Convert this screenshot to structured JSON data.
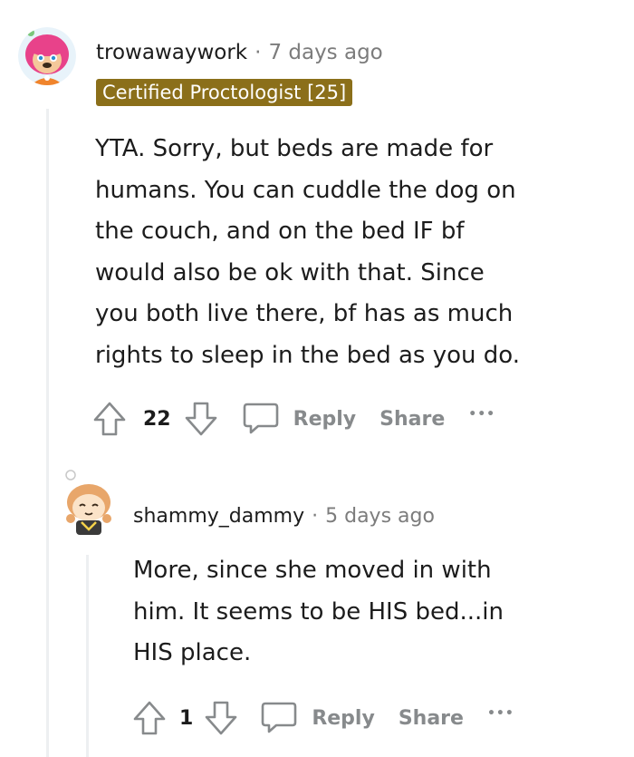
{
  "comments": [
    {
      "username": "trowawaywork",
      "time": "7 days ago",
      "flair": "Certified Proctologist [25]",
      "body_lines": [
        "YTA. Sorry, but beds are made for",
        "humans. You can cuddle the dog on",
        "the couch, and on the bed IF bf",
        "would also be ok with that. Since",
        "you both live there, bf has as much",
        "rights to sleep in the bed as you do."
      ],
      "votes": "22",
      "reply_label": "Reply",
      "share_label": "Share",
      "more_label": "•••"
    },
    {
      "username": "shammy_dammy",
      "time": "5 days ago",
      "body_lines": [
        "More, since she moved in with",
        "him. It seems to be HIS bed...in",
        "HIS place."
      ],
      "votes": "1",
      "reply_label": "Reply",
      "share_label": "Share",
      "more_label": "•••"
    }
  ],
  "separator": "·",
  "colors": {
    "flair_bg": "#8b6f1a",
    "meta_gray": "#7c7c7c",
    "action_gray": "#878a8c"
  }
}
